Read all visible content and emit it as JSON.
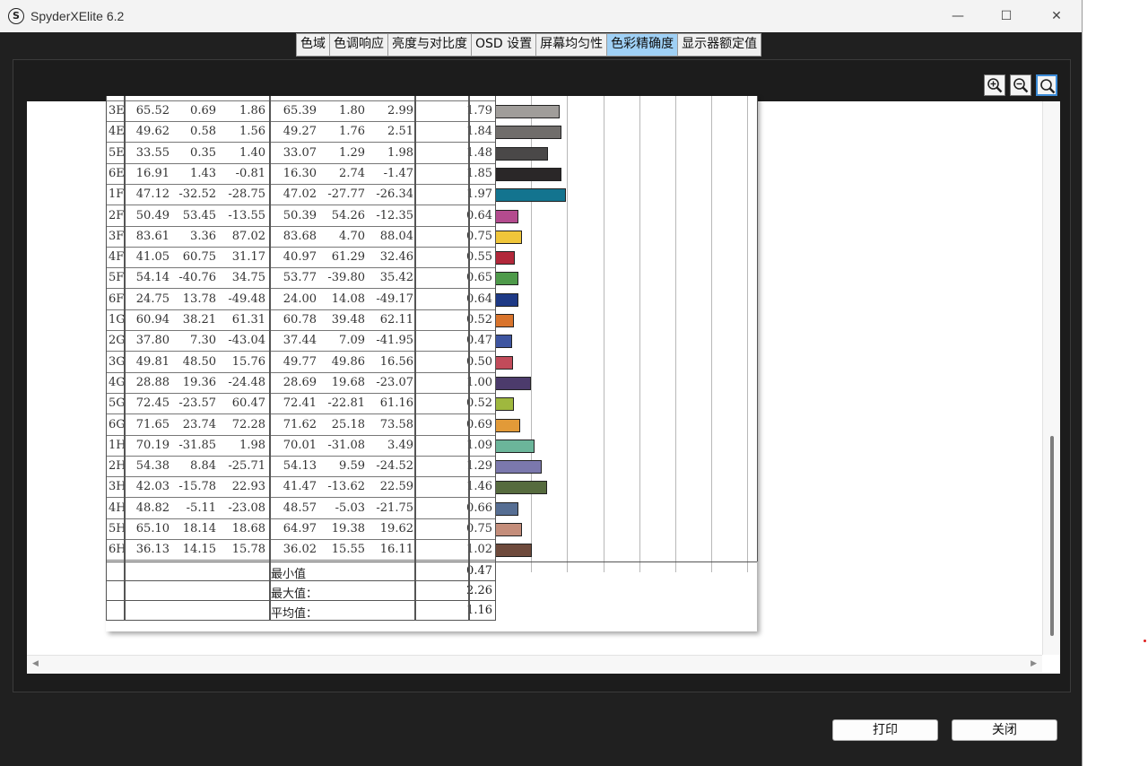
{
  "window": {
    "title": "SpyderXElite 6.2",
    "app_icon": "S"
  },
  "window_controls": {
    "minimize": "—",
    "maximize": "☐",
    "close": "✕"
  },
  "tabs": [
    {
      "label": "色域"
    },
    {
      "label": "色调响应"
    },
    {
      "label": "亮度与对比度"
    },
    {
      "label": "OSD 设置"
    },
    {
      "label": "屏幕均匀性"
    },
    {
      "label": "色彩精确度",
      "active": true
    },
    {
      "label": "显示器额定值"
    }
  ],
  "toolbar": {
    "icons": [
      "zoom-in-icon",
      "zoom-out-icon",
      "zoom-fit-icon"
    ],
    "active": "zoom-fit-icon"
  },
  "rows": [
    {
      "id": "3E",
      "v": [
        "65.52",
        "0.69",
        "1.86",
        "65.39",
        "1.80",
        "2.99"
      ],
      "de": "1.79",
      "color": "#a09d9a"
    },
    {
      "id": "4E",
      "v": [
        "49.62",
        "0.58",
        "1.56",
        "49.27",
        "1.76",
        "2.51"
      ],
      "de": "1.84",
      "color": "#706d6b"
    },
    {
      "id": "5E",
      "v": [
        "33.55",
        "0.35",
        "1.40",
        "33.07",
        "1.29",
        "1.98"
      ],
      "de": "1.48",
      "color": "#4a4848"
    },
    {
      "id": "6E",
      "v": [
        "16.91",
        "1.43",
        "-0.81",
        "16.30",
        "2.74",
        "-1.47"
      ],
      "de": "1.85",
      "color": "#2a2728"
    },
    {
      "id": "1F",
      "v": [
        "47.12",
        "-32.52",
        "-28.75",
        "47.02",
        "-27.77",
        "-26.34"
      ],
      "de": "1.97",
      "color": "#13748f"
    },
    {
      "id": "2F",
      "v": [
        "50.49",
        "53.45",
        "-13.55",
        "50.39",
        "54.26",
        "-12.35"
      ],
      "de": "0.64",
      "color": "#b44b8e"
    },
    {
      "id": "3F",
      "v": [
        "83.61",
        "3.36",
        "87.02",
        "83.68",
        "4.70",
        "88.04"
      ],
      "de": "0.75",
      "color": "#f0c63a"
    },
    {
      "id": "4F",
      "v": [
        "41.05",
        "60.75",
        "31.17",
        "40.97",
        "61.29",
        "32.46"
      ],
      "de": "0.55",
      "color": "#b2283a"
    },
    {
      "id": "5F",
      "v": [
        "54.14",
        "-40.76",
        "34.75",
        "53.77",
        "-39.80",
        "35.42"
      ],
      "de": "0.65",
      "color": "#4e9a4a"
    },
    {
      "id": "6F",
      "v": [
        "24.75",
        "13.78",
        "-49.48",
        "24.00",
        "14.08",
        "-49.17"
      ],
      "de": "0.64",
      "color": "#1e3a86"
    },
    {
      "id": "1G",
      "v": [
        "60.94",
        "38.21",
        "61.31",
        "60.78",
        "39.48",
        "62.11"
      ],
      "de": "0.52",
      "color": "#d9742c"
    },
    {
      "id": "2G",
      "v": [
        "37.80",
        "7.30",
        "-43.04",
        "37.44",
        "7.09",
        "-41.95"
      ],
      "de": "0.47",
      "color": "#3e55a0"
    },
    {
      "id": "3G",
      "v": [
        "49.81",
        "48.50",
        "15.76",
        "49.77",
        "49.86",
        "16.56"
      ],
      "de": "0.50",
      "color": "#c24b5a"
    },
    {
      "id": "4G",
      "v": [
        "28.88",
        "19.36",
        "-24.48",
        "28.69",
        "19.68",
        "-23.07"
      ],
      "de": "1.00",
      "color": "#4c3b6c"
    },
    {
      "id": "5G",
      "v": [
        "72.45",
        "-23.57",
        "60.47",
        "72.41",
        "-22.81",
        "61.16"
      ],
      "de": "0.52",
      "color": "#9fb83e"
    },
    {
      "id": "6G",
      "v": [
        "71.65",
        "23.74",
        "72.28",
        "71.62",
        "25.18",
        "73.58"
      ],
      "de": "0.69",
      "color": "#e29a38"
    },
    {
      "id": "1H",
      "v": [
        "70.19",
        "-31.85",
        "1.98",
        "70.01",
        "-31.08",
        "3.49"
      ],
      "de": "1.09",
      "color": "#6bb59a"
    },
    {
      "id": "2H",
      "v": [
        "54.38",
        "8.84",
        "-25.71",
        "54.13",
        "9.59",
        "-24.52"
      ],
      "de": "1.29",
      "color": "#7b78ad"
    },
    {
      "id": "3H",
      "v": [
        "42.03",
        "-15.78",
        "22.93",
        "41.47",
        "-13.62",
        "22.59"
      ],
      "de": "1.46",
      "color": "#566b3e"
    },
    {
      "id": "4H",
      "v": [
        "48.82",
        "-5.11",
        "-23.08",
        "48.57",
        "-5.03",
        "-21.75"
      ],
      "de": "0.66",
      "color": "#566e93"
    },
    {
      "id": "5H",
      "v": [
        "65.10",
        "18.14",
        "18.68",
        "64.97",
        "19.38",
        "19.62"
      ],
      "de": "0.75",
      "color": "#c48d7a"
    },
    {
      "id": "6H",
      "v": [
        "36.13",
        "14.15",
        "15.78",
        "36.02",
        "15.55",
        "16.11"
      ],
      "de": "1.02",
      "color": "#6e4a3c"
    }
  ],
  "summary": [
    {
      "label": "最小值",
      "value": "0.47"
    },
    {
      "label": "最大值：",
      "value": "2.26"
    },
    {
      "label": "平均值：",
      "value": "1.16"
    }
  ],
  "buttons": {
    "print": "打印",
    "close": "关闭"
  }
}
